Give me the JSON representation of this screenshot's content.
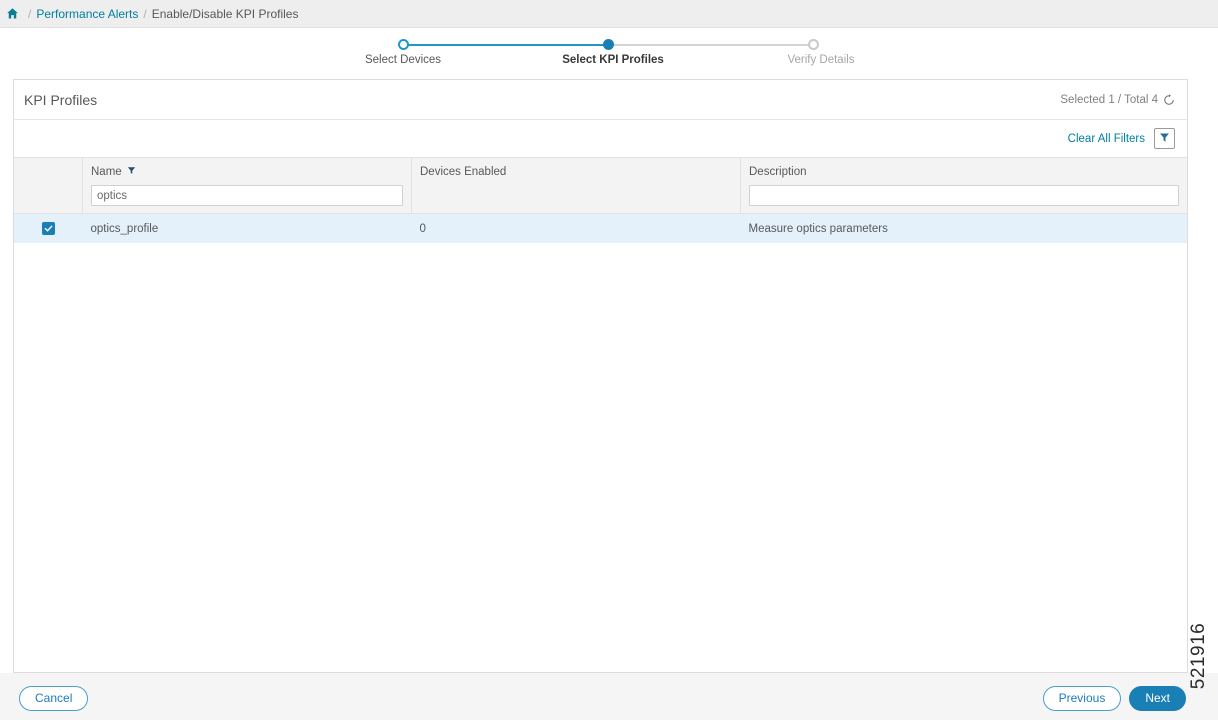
{
  "breadcrumb": {
    "home_icon": "home-icon",
    "separator": "/",
    "items": [
      {
        "label": "Performance Alerts",
        "current": false
      },
      {
        "label": "Enable/Disable KPI Profiles",
        "current": true
      }
    ]
  },
  "stepper": {
    "steps": [
      {
        "label": "Select Devices",
        "state": "complete"
      },
      {
        "label": "Select KPI Profiles",
        "state": "active"
      },
      {
        "label": "Verify Details",
        "state": "pending"
      }
    ],
    "accent_color": "#2096cc",
    "active_color": "#1a7fb5",
    "inactive_color": "#d4d4d4"
  },
  "panel": {
    "title": "KPI Profiles",
    "count_label": "Selected 1 / Total 4",
    "refresh_icon": "refresh-icon",
    "clear_filters_label": "Clear All Filters",
    "filter_icon": "filter-funnel-icon"
  },
  "table": {
    "columns": [
      {
        "key": "check",
        "label": "",
        "filterable": false
      },
      {
        "key": "name",
        "label": "Name",
        "filterable": true,
        "has_filter_icon": true,
        "filter_value": "optics"
      },
      {
        "key": "devices_enabled",
        "label": "Devices Enabled",
        "filterable": false
      },
      {
        "key": "description",
        "label": "Description",
        "filterable": true,
        "has_filter_icon": false,
        "filter_value": ""
      }
    ],
    "rows": [
      {
        "selected": true,
        "name": "optics_profile",
        "devices_enabled": "0",
        "description": "Measure optics parameters"
      }
    ]
  },
  "footer": {
    "cancel_label": "Cancel",
    "previous_label": "Previous",
    "next_label": "Next"
  },
  "doc_id": "521916",
  "colors": {
    "link": "#007f9e",
    "primary": "#1a7fb5",
    "row_selected_bg": "#e4f1fa",
    "header_bg": "#f3f3f3",
    "breadcrumb_bg": "#eeeeee",
    "footer_bg": "#f5f5f5"
  }
}
